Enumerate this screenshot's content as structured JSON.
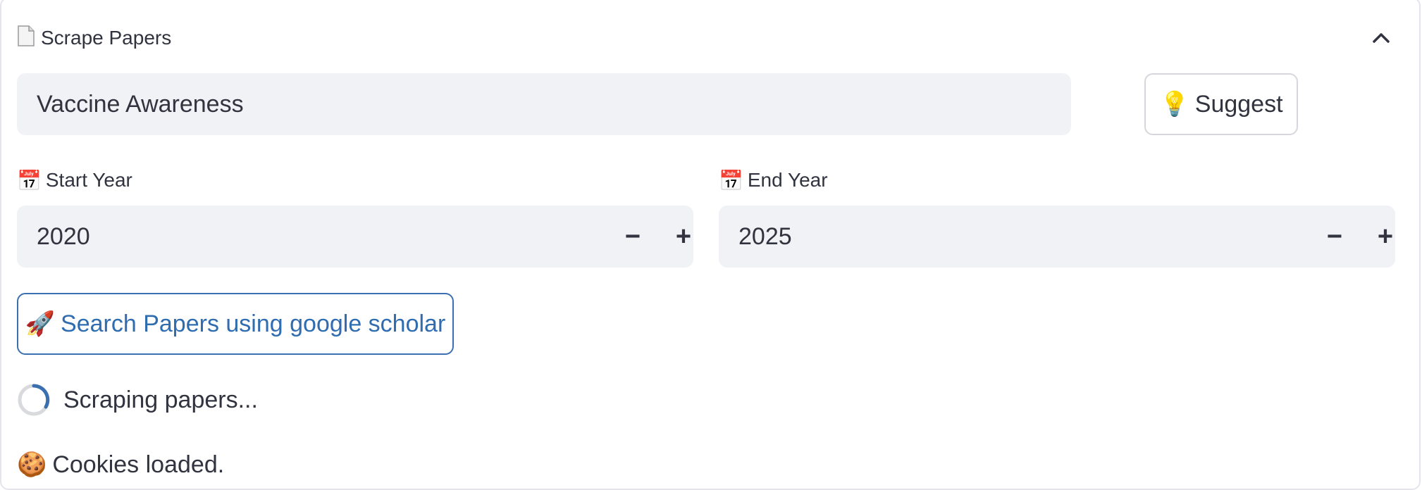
{
  "expander": {
    "icon": "page-icon",
    "title": "Scrape Papers",
    "chevron": "chevron-up-icon"
  },
  "topic": {
    "value": "Vaccine Awareness"
  },
  "suggest_button": {
    "icon": "lightbulb-icon",
    "emoji": "💡",
    "label": "Suggest"
  },
  "start_year": {
    "icon": "calendar-icon",
    "emoji": "📅",
    "label": "Start Year",
    "value": "2020",
    "decrement": "−",
    "increment": "+"
  },
  "end_year": {
    "icon": "calendar-icon",
    "emoji": "📅",
    "label": "End Year",
    "value": "2025",
    "decrement": "−",
    "increment": "+"
  },
  "search_button": {
    "icon": "rocket-icon",
    "emoji": "🚀",
    "label": "Search Papers using google scholar"
  },
  "status": {
    "icon": "spinner-icon",
    "text": "Scraping papers..."
  },
  "cookies": {
    "icon": "cookie-icon",
    "emoji": "🍪",
    "text": "Cookies loaded."
  },
  "colors": {
    "accent": "#2f6cb0",
    "input_bg": "#f0f2f6",
    "text": "#31333f",
    "border": "#d6d7dc"
  }
}
